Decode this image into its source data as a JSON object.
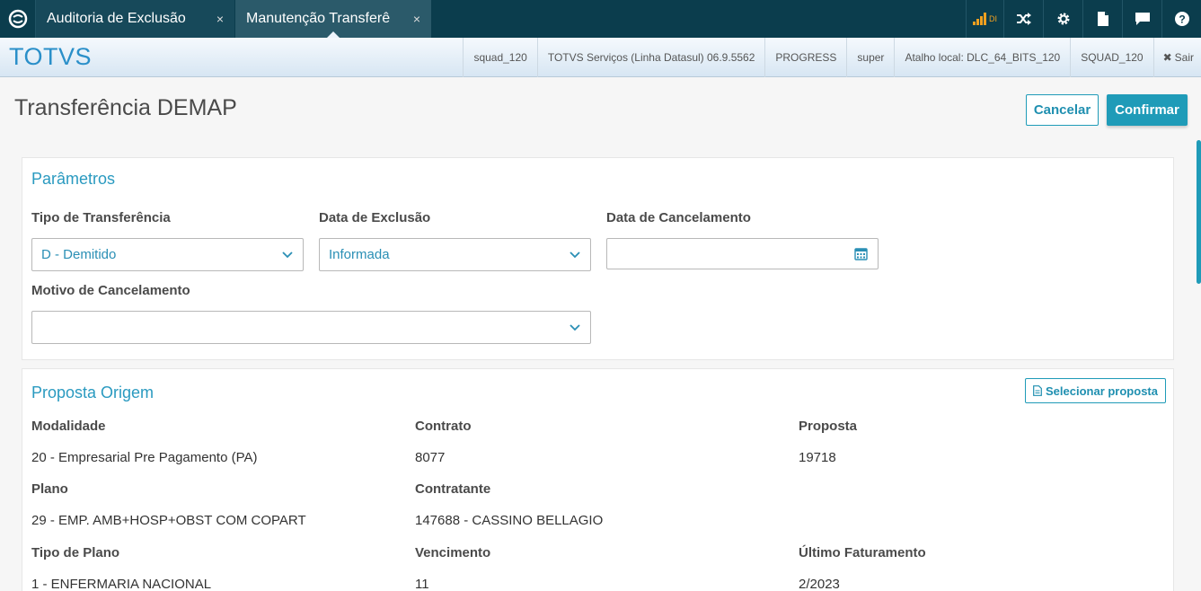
{
  "tabs": [
    {
      "label": "Auditoria de Exclusão",
      "close": "×"
    },
    {
      "label": "Manutenção Transferê",
      "close": "×"
    }
  ],
  "topbar_icons": [
    "signal-icon",
    "shuffle-icon",
    "gear-icon",
    "document-icon",
    "chat-icon",
    "help-icon"
  ],
  "topbar_signal_text": "DI",
  "header": {
    "brand": "TOTVS",
    "info": [
      "squad_120",
      "TOTVS Serviços (Linha Datasul) 06.9.5562",
      "PROGRESS",
      "super",
      "Atalho local: DLC_64_BITS_120",
      "SQUAD_120"
    ],
    "exit_label": "Sair"
  },
  "page": {
    "title": "Transferência DEMAP",
    "cancel_label": "Cancelar",
    "confirm_label": "Confirmar"
  },
  "parametros": {
    "title": "Parâmetros",
    "tipo_transferencia": {
      "label": "Tipo de Transferência",
      "value": "D - Demitido"
    },
    "data_exclusao": {
      "label": "Data de Exclusão",
      "value": "Informada"
    },
    "data_cancelamento": {
      "label": "Data de Cancelamento",
      "value": ""
    },
    "motivo_cancelamento": {
      "label": "Motivo de Cancelamento",
      "value": ""
    }
  },
  "proposta_origem": {
    "title": "Proposta Origem",
    "select_label": "Selecionar proposta",
    "modalidade": {
      "label": "Modalidade",
      "value": "20 - Empresarial Pre Pagamento (PA)"
    },
    "contrato": {
      "label": "Contrato",
      "value": "8077"
    },
    "proposta": {
      "label": "Proposta",
      "value": "19718"
    },
    "plano": {
      "label": "Plano",
      "value": "29 - EMP. AMB+HOSP+OBST COM COPART"
    },
    "contratante": {
      "label": "Contratante",
      "value": "147688 - CASSINO BELLAGIO"
    },
    "tipo_plano": {
      "label": "Tipo de Plano",
      "value": "1 - ENFERMARIA NACIONAL"
    },
    "vencimento": {
      "label": "Vencimento",
      "value": "11"
    },
    "ultimo_faturamento": {
      "label": "Último Faturamento",
      "value": "2/2023"
    }
  }
}
